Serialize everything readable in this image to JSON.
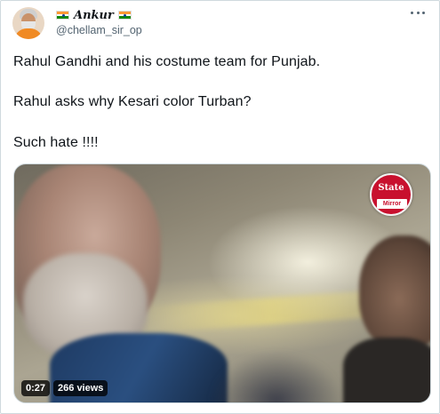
{
  "user": {
    "display_name": "Ankur",
    "handle": "@chellam_sir_op"
  },
  "tweet": {
    "lines": [
      "Rahul Gandhi and his costume team for Punjab.",
      "Rahul asks why Kesari color Turban?",
      "Such hate !!!!"
    ]
  },
  "media": {
    "duration": "0:27",
    "views": "266 views",
    "watermark_top": "State",
    "watermark_bottom": "Mirror"
  },
  "icons": {
    "flag": "india-flag-emoji",
    "more": "more-options-icon"
  },
  "colors": {
    "flag_saffron": "#ff9933",
    "flag_green": "#138808",
    "secondary_text": "#536471",
    "watermark_red": "#c8102e"
  }
}
